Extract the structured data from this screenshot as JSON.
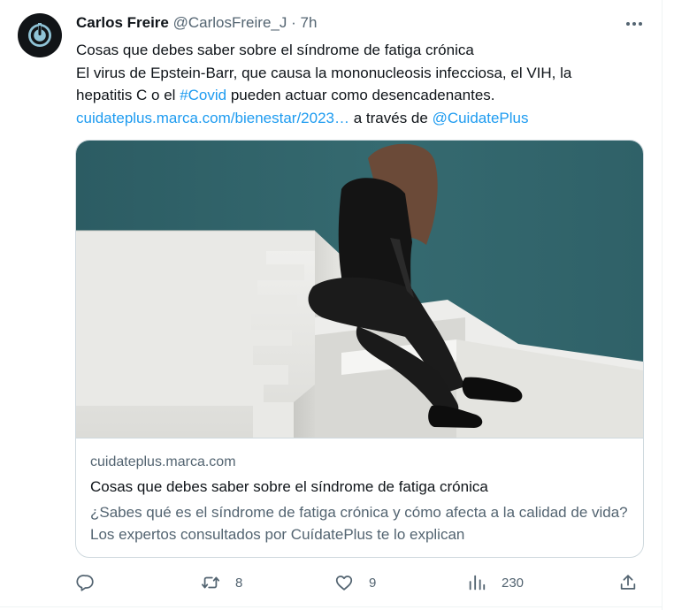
{
  "author": {
    "name": "Carlos Freire",
    "handle": "@CarlosFreire_J",
    "separator": "·",
    "time": "7h"
  },
  "tweet": {
    "line1": "Cosas que debes saber sobre el síndrome de fatiga crónica",
    "line2": "El virus de Epstein-Barr, que causa la mononucleosis infecciosa, el VIH, la",
    "line3_pre": "hepatitis C o el ",
    "hashtag": "#Covid",
    "line3_post": " pueden actuar como desencadenantes.",
    "url": "cuidateplus.marca.com/bienestar/2023…",
    "via_text": " a través de ",
    "mention": "@CuidatePlus"
  },
  "card": {
    "domain": "cuidateplus.marca.com",
    "title": "Cosas que debes saber sobre el síndrome de fatiga crónica",
    "description": "¿Sabes qué es el síndrome de fatiga crónica y cómo afecta a la calidad de vida? Los expertos consultados por CuídatePlus te lo explican"
  },
  "actions": {
    "replies": "",
    "retweets": "8",
    "likes": "9",
    "views": "230"
  },
  "icons": {
    "avatar": "power-icon",
    "more": "more-dots-icon",
    "reply": "reply-icon",
    "retweet": "retweet-icon",
    "like": "heart-icon",
    "views": "views-chart-icon",
    "share": "share-icon"
  },
  "colors": {
    "link": "#1d9bf0",
    "secondary_text": "#536471",
    "primary_text": "#0f1419",
    "border": "#cfd9de"
  }
}
